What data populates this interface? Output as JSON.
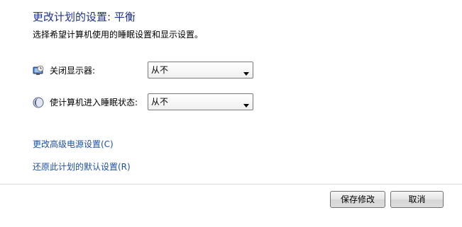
{
  "header": {
    "title": "更改计划的设置: 平衡",
    "subtitle": "选择希望计算机使用的睡眠设置和显示设置。"
  },
  "settings": [
    {
      "icon": "monitor-clock-icon",
      "label": "关闭显示器:",
      "value": "从不"
    },
    {
      "icon": "moon-sleep-icon",
      "label": "使计算机进入睡眠状态:",
      "value": "从不"
    }
  ],
  "links": {
    "advanced": "更改高级电源设置(C)",
    "restore": "还原此计划的默认设置(R)"
  },
  "buttons": {
    "save": "保存修改",
    "cancel": "取消"
  },
  "colors": {
    "title": "#1e3287",
    "link": "#1e50a0"
  }
}
